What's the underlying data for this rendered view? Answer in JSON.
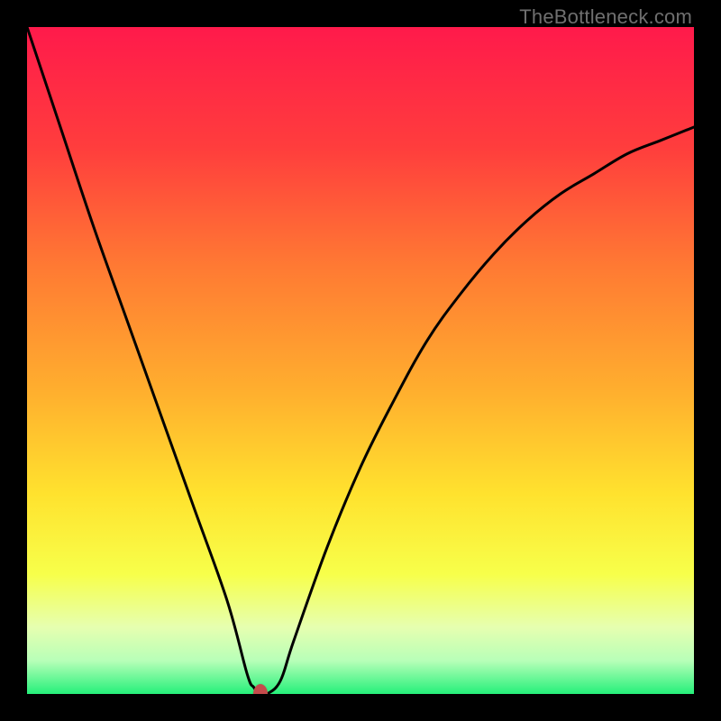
{
  "watermark": "TheBottleneck.com",
  "colors": {
    "frame": "#000000",
    "curve": "#000000",
    "marker": "#c44b4b",
    "gradient_stops": [
      {
        "pct": 0,
        "color": "#ff1a4b"
      },
      {
        "pct": 18,
        "color": "#ff3d3d"
      },
      {
        "pct": 36,
        "color": "#ff7a33"
      },
      {
        "pct": 55,
        "color": "#ffb02e"
      },
      {
        "pct": 70,
        "color": "#ffe22e"
      },
      {
        "pct": 82,
        "color": "#f7ff4a"
      },
      {
        "pct": 90,
        "color": "#e6ffb0"
      },
      {
        "pct": 95,
        "color": "#b8ffb8"
      },
      {
        "pct": 100,
        "color": "#25f07a"
      }
    ]
  },
  "chart_data": {
    "type": "line",
    "title": "",
    "xlabel": "",
    "ylabel": "",
    "xlim": [
      0,
      100
    ],
    "ylim": [
      0,
      100
    ],
    "grid": false,
    "legend": false,
    "series": [
      {
        "name": "bottleneck-curve",
        "x": [
          0,
          5,
          10,
          15,
          20,
          25,
          30,
          33,
          34,
          35,
          36,
          38,
          40,
          45,
          50,
          55,
          60,
          65,
          70,
          75,
          80,
          85,
          90,
          95,
          100
        ],
        "y": [
          100,
          85,
          70,
          56,
          42,
          28,
          14,
          3,
          1,
          0,
          0,
          2,
          8,
          22,
          34,
          44,
          53,
          60,
          66,
          71,
          75,
          78,
          81,
          83,
          85
        ]
      }
    ],
    "annotations": [
      {
        "name": "optimal-point",
        "x": 35,
        "y": 0
      }
    ]
  }
}
